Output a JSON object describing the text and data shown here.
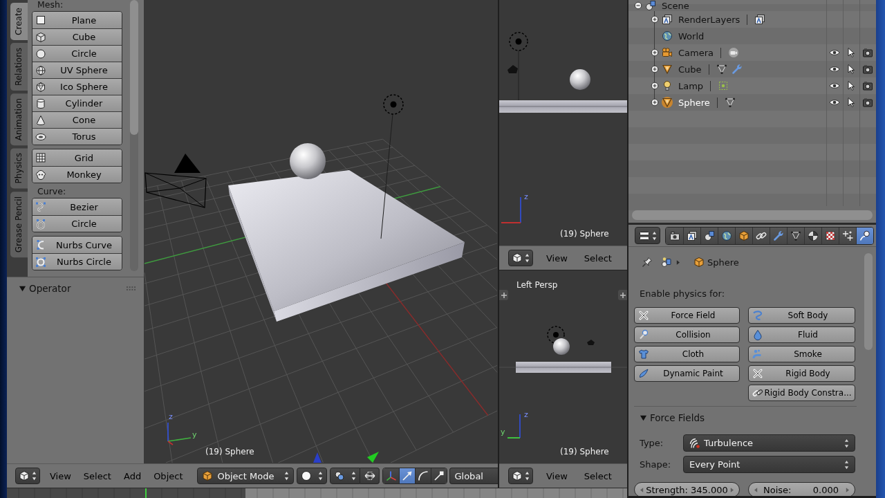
{
  "toolshelf": {
    "tabs": [
      {
        "label": "Create",
        "selected": true
      },
      {
        "label": "Relations",
        "selected": false
      },
      {
        "label": "Animation",
        "selected": false
      },
      {
        "label": "Physics",
        "selected": false
      },
      {
        "label": "Grease Pencil",
        "selected": false
      }
    ],
    "sections": [
      {
        "title": "Mesh:",
        "groups": [
          [
            {
              "label": "Plane",
              "kind": "plane"
            },
            {
              "label": "Cube",
              "kind": "cube"
            },
            {
              "label": "Circle",
              "kind": "circle"
            },
            {
              "label": "UV Sphere",
              "kind": "uv-sphere"
            },
            {
              "label": "Ico Sphere",
              "kind": "ico-sphere"
            },
            {
              "label": "Cylinder",
              "kind": "cylinder"
            },
            {
              "label": "Cone",
              "kind": "cone"
            },
            {
              "label": "Torus",
              "kind": "torus"
            }
          ],
          [
            {
              "label": "Grid",
              "kind": "grid"
            },
            {
              "label": "Monkey",
              "kind": "monkey"
            }
          ]
        ]
      },
      {
        "title": "Curve:",
        "groups": [
          [
            {
              "label": "Bezier",
              "kind": "bezier"
            },
            {
              "label": "Circle",
              "kind": "curve-circle"
            }
          ],
          [
            {
              "label": "Nurbs Curve",
              "kind": "nurbs-curve"
            },
            {
              "label": "Nurbs Circle",
              "kind": "nurbs-circle"
            }
          ]
        ]
      }
    ]
  },
  "operator_panel": {
    "title": "Operator",
    "expanded": true
  },
  "main_view": {
    "object_label": "(19) Sphere",
    "axis_labels": [
      {
        "kind": "z",
        "label": "z"
      },
      {
        "kind": "y",
        "label": "y"
      }
    ],
    "header": {
      "menus": [
        "View",
        "Select",
        "Add",
        "Object"
      ],
      "mode": "Object Mode",
      "manipulators": [
        {
          "kind": "axes",
          "selected": false
        },
        {
          "kind": "translate",
          "selected": true
        },
        {
          "kind": "rotate",
          "selected": false
        },
        {
          "kind": "scale",
          "selected": false
        }
      ],
      "orientation": "Global"
    }
  },
  "side_view_top": {
    "object_label": "(19) Sphere",
    "axis_labels": [
      {
        "kind": "z",
        "label": "z"
      }
    ],
    "header": {
      "menus": [
        "View",
        "Select"
      ]
    }
  },
  "side_view_bottom": {
    "view_name": "Left Persp",
    "object_label": "(19) Sphere",
    "axis_labels": [
      {
        "kind": "z",
        "label": "z"
      },
      {
        "kind": "y",
        "label": "y"
      }
    ],
    "header": {
      "menus": [
        "View",
        "Select"
      ]
    }
  },
  "outliner": {
    "tree": [
      {
        "label": "Scene",
        "kind": "scene",
        "expanded": true,
        "selected": false,
        "children": [
          {
            "label": "RenderLayers",
            "kind": "render-layers",
            "expanded": false,
            "selected": false,
            "data": [
              {
                "kind": "render-layer"
              }
            ]
          },
          {
            "label": "World",
            "kind": "world",
            "selected": false
          },
          {
            "label": "Camera",
            "kind": "camera",
            "expanded": false,
            "selected": false,
            "data": [
              {
                "kind": "camera-data"
              }
            ]
          },
          {
            "label": "Cube",
            "kind": "mesh",
            "expanded": false,
            "selected": false,
            "data": [
              {
                "kind": "mesh-data"
              },
              {
                "kind": "modifier"
              }
            ]
          },
          {
            "label": "Lamp",
            "kind": "lamp",
            "expanded": false,
            "selected": false,
            "data": [
              {
                "kind": "lamp-data"
              }
            ]
          },
          {
            "label": "Sphere",
            "kind": "mesh",
            "expanded": false,
            "selected": true,
            "data": [
              {
                "kind": "mesh-data"
              }
            ]
          }
        ]
      }
    ]
  },
  "properties": {
    "context_tabs": [
      {
        "kind": "render",
        "selected": false
      },
      {
        "kind": "render-layers",
        "selected": false
      },
      {
        "kind": "scene",
        "selected": false
      },
      {
        "kind": "world",
        "selected": false
      },
      {
        "kind": "object",
        "selected": false
      },
      {
        "kind": "constraints",
        "selected": false
      },
      {
        "kind": "modifiers",
        "selected": false
      },
      {
        "kind": "data",
        "selected": false
      },
      {
        "kind": "material",
        "selected": false
      },
      {
        "kind": "texture",
        "selected": false
      },
      {
        "kind": "particles",
        "selected": false
      },
      {
        "kind": "physics",
        "selected": true
      }
    ],
    "breadcrumb": {
      "object": "Sphere"
    },
    "enable_label": "Enable physics for:",
    "physics_columns": [
      [
        {
          "label": "Force Field",
          "enabled": true
        },
        {
          "label": "Collision",
          "kind": "collision",
          "enabled": false
        },
        {
          "label": "Cloth",
          "kind": "cloth",
          "enabled": false
        },
        {
          "label": "Dynamic Paint",
          "kind": "dynamic-paint",
          "enabled": false
        }
      ],
      [
        {
          "label": "Soft Body",
          "kind": "soft-body",
          "enabled": false
        },
        {
          "label": "Fluid",
          "kind": "fluid",
          "enabled": false
        },
        {
          "label": "Smoke",
          "kind": "smoke",
          "enabled": false
        },
        {
          "label": "Rigid Body",
          "enabled": true
        },
        {
          "label": "Rigid Body Constra...",
          "kind": "rigid-body-constraint",
          "enabled": false
        }
      ]
    ],
    "force_fields": {
      "title": "Force Fields",
      "expanded": true,
      "type_label": "Type:",
      "type_value": "Turbulence",
      "shape_label": "Shape:",
      "shape_value": "Every Point",
      "strength": "Strength: 345.000",
      "noise_label": "Noise:",
      "noise_value": "0.000"
    }
  }
}
